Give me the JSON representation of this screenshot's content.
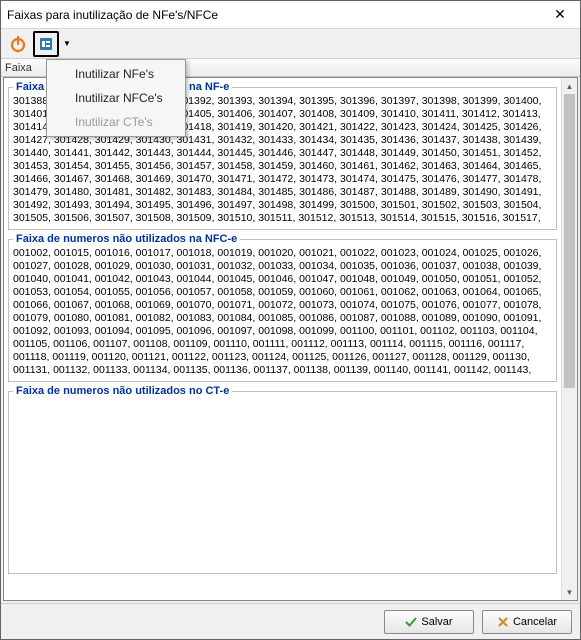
{
  "window": {
    "title": "Faixas para inutilização de NFe's/NFCe"
  },
  "toolbar": {
    "power_icon": "power-icon",
    "doc_icon": "doc-icon"
  },
  "header": {
    "col1": "Faixa"
  },
  "menu": {
    "items": [
      {
        "label": "Inutilizar NFe's",
        "enabled": true
      },
      {
        "label": "Inutilizar NFCe's",
        "enabled": true
      },
      {
        "label": "Inutilizar CTe's",
        "enabled": false
      }
    ]
  },
  "sections": {
    "nfe": {
      "legend": "Faixa de numeros não utilizados na NF-e",
      "text": "301388, 301389, 301390, 301391, 301392, 301393, 301394, 301395, 301396, 301397, 301398, 301399, 301400, 301401, 301402, 301403, 301404, 301405, 301406, 301407, 301408, 301409, 301410, 301411, 301412, 301413, 301414, 301415, 301416, 301417, 301418, 301419, 301420, 301421, 301422, 301423, 301424, 301425, 301426, 301427, 301428, 301429, 301430, 301431, 301432, 301433, 301434, 301435, 301436, 301437, 301438, 301439, 301440, 301441, 301442, 301443, 301444, 301445, 301446, 301447, 301448, 301449, 301450, 301451, 301452, 301453, 301454, 301455, 301456, 301457, 301458, 301459, 301460, 301461, 301462, 301463, 301464, 301465, 301466, 301467, 301468, 301469, 301470, 301471, 301472, 301473, 301474, 301475, 301476, 301477, 301478, 301479, 301480, 301481, 301482, 301483, 301484, 301485, 301486, 301487, 301488, 301489, 301490, 301491, 301492, 301493, 301494, 301495, 301496, 301497, 301498, 301499, 301500, 301501, 301502, 301503, 301504, 301505, 301506, 301507, 301508, 301509, 301510, 301511, 301512, 301513, 301514, 301515, 301516, 301517,"
    },
    "nfce": {
      "legend": "Faixa de numeros não utilizados na NFC-e",
      "text": "001002, 001015, 001016, 001017, 001018, 001019, 001020, 001021, 001022, 001023, 001024, 001025, 001026, 001027, 001028, 001029, 001030, 001031, 001032, 001033, 001034, 001035, 001036, 001037, 001038, 001039, 001040, 001041, 001042, 001043, 001044, 001045, 001046, 001047, 001048, 001049, 001050, 001051, 001052, 001053, 001054, 001055, 001056, 001057, 001058, 001059, 001060, 001061, 001062, 001063, 001064, 001065, 001066, 001067, 001068, 001069, 001070, 001071, 001072, 001073, 001074, 001075, 001076, 001077, 001078, 001079, 001080, 001081, 001082, 001083, 001084, 001085, 001086, 001087, 001088, 001089, 001090, 001091, 001092, 001093, 001094, 001095, 001096, 001097, 001098, 001099, 001100, 001101, 001102, 001103, 001104, 001105, 001106, 001107, 001108, 001109, 001110, 001111, 001112, 001113, 001114, 001115, 001116, 001117, 001118, 001119, 001120, 001121, 001122, 001123, 001124, 001125, 001126, 001127, 001128, 001129, 001130, 001131, 001132, 001133, 001134, 001135, 001136, 001137, 001138, 001139, 001140, 001141, 001142, 001143,"
    },
    "cte": {
      "legend": "Faixa de numeros não utilizados no CT-e",
      "text": ""
    }
  },
  "footer": {
    "save": "Salvar",
    "cancel": "Cancelar"
  }
}
